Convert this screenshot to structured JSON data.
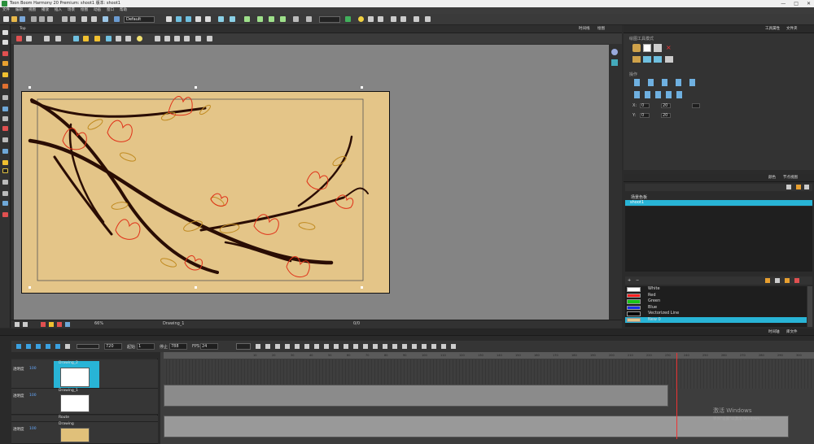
{
  "window": {
    "title": "Toon Boom Harmony 20 Premium: shoot1 版本: shoot1",
    "controls": [
      "—",
      "□",
      "✕"
    ]
  },
  "menubar": [
    "文件",
    "编辑",
    "视图",
    "播放",
    "插入",
    "场景",
    "绘图",
    "动画",
    "窗口",
    "帮助"
  ],
  "toolbar": {
    "workspace_select": "Default"
  },
  "camera_view": {
    "tab_label": "Top",
    "right_tabs": [
      "时间线",
      "绘图"
    ],
    "bottom_zoom": "66%",
    "bottom_layer": "Drawing_1",
    "bottom_status": "0/0"
  },
  "tool_properties": {
    "tabs": [
      "工具属性",
      "文件夹"
    ],
    "section_draw_mode": "绘图工具模式",
    "section_ops": "操作",
    "x_label": "X:",
    "x_value": "0",
    "y_label": "Y:",
    "y_value": "0",
    "w_value": "20",
    "h_value": "20"
  },
  "palette_panel": {
    "tabs": [
      "颜色",
      "节点视图"
    ],
    "list_header": "场景色板",
    "selected_palette": "shoot1",
    "swatches": [
      {
        "name": "White",
        "color": "#ffffff"
      },
      {
        "name": "Red",
        "color": "#ff2020"
      },
      {
        "name": "Green",
        "color": "#18c418"
      },
      {
        "name": "Blue",
        "color": "#1830e8"
      },
      {
        "name": "Vectorized Line",
        "color": "#000000"
      },
      {
        "name": "New 0",
        "color": "#e3c58a"
      }
    ]
  },
  "timeline": {
    "tabs": [
      "时间轴",
      "库文件"
    ],
    "frame_field": "720",
    "start_label": "起始",
    "start_value": "1",
    "stop_label": "停止",
    "stop_value": "788",
    "fps_label": "FPS",
    "fps_value": "24",
    "layers": [
      {
        "name": "Drawing_2",
        "mode": "透明度",
        "value": "100"
      },
      {
        "name": "Drawing_1",
        "mode": "透明度",
        "value": "100"
      },
      {
        "name": "Drawing",
        "mode": "透明度",
        "value": "100"
      }
    ],
    "peg_label": "Route",
    "ruler_marks": [
      "10",
      "20",
      "30",
      "40",
      "50",
      "60",
      "70",
      "80",
      "90",
      "100",
      "110",
      "120",
      "130",
      "140",
      "150",
      "160",
      "170",
      "180",
      "190",
      "200",
      "210",
      "220",
      "230",
      "240",
      "250",
      "260",
      "270",
      "280",
      "290",
      "300"
    ]
  },
  "overlay": {
    "activate_title": "激活 Windows",
    "activate_sub": "转到\"设置\"以激活 Windows。"
  },
  "colors": {
    "accent": "#28b4d6",
    "paper": "#e4c588",
    "stage": "#848484",
    "playhead": "#ee3333"
  }
}
